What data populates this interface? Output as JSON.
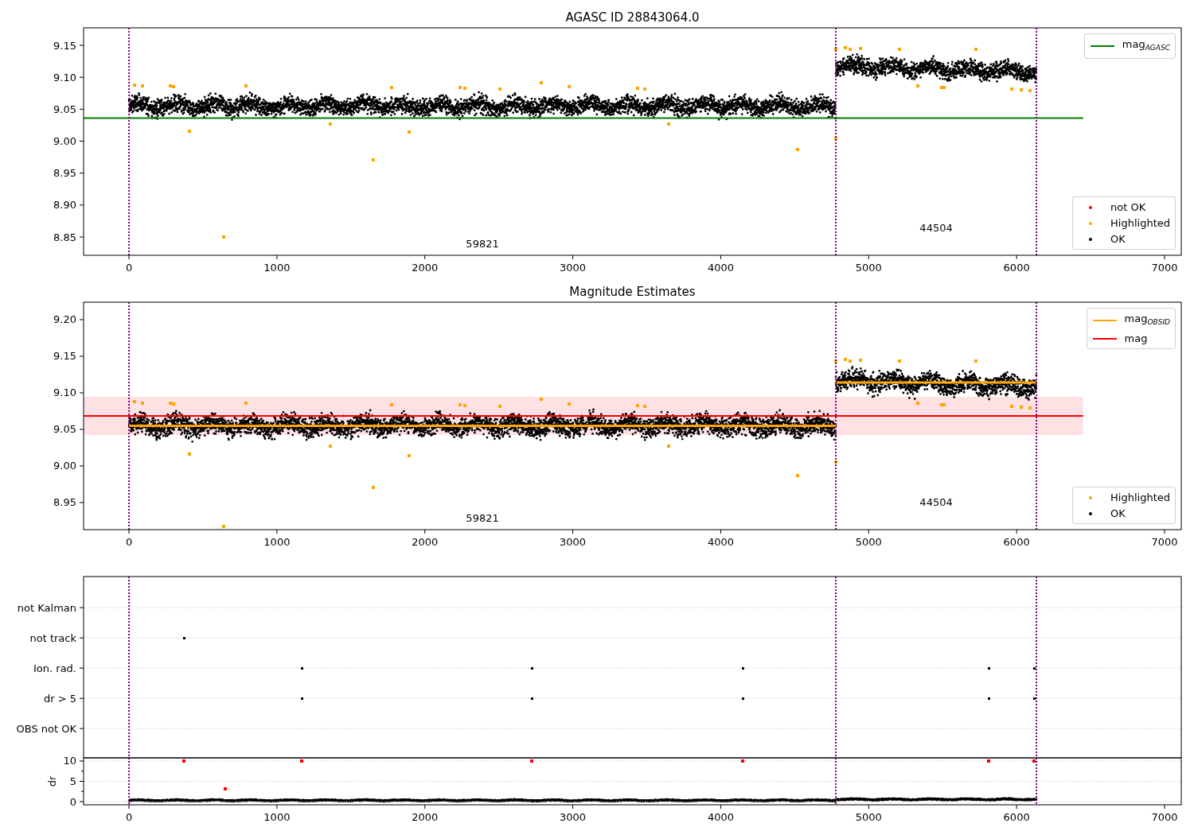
{
  "figure": {
    "panels": [
      {
        "kind": "magnitude",
        "title": "AGASC ID 28843064.0",
        "chart_data": {
          "type": "scatter",
          "xlim": [
            -307,
            7113
          ],
          "ylim": [
            8.8214,
            9.1774
          ],
          "xticks": [
            0,
            1000,
            2000,
            3000,
            4000,
            5000,
            6000,
            7000
          ],
          "yticks": [
            {
              "value": 8.85,
              "label": "8.85"
            },
            {
              "value": 8.9,
              "label": "8.90"
            },
            {
              "value": 8.95,
              "label": "8.95"
            },
            {
              "value": 9.0,
              "label": "9.00"
            },
            {
              "value": 9.05,
              "label": "9.05"
            },
            {
              "value": 9.1,
              "label": "9.10"
            },
            {
              "value": 9.15,
              "label": "9.15"
            }
          ],
          "series": [
            {
              "color": "#ffa500",
              "x": [
                38,
                91,
                280,
                301,
                409,
                640,
                791,
                1361,
                1652,
                1776,
                1894,
                2238,
                2270,
                2507,
                2787,
                2975,
                3438,
                3487,
                3648,
                4520,
                4778,
                4778,
                4843,
                4875,
                4945,
                5208,
                5332,
                5493,
                5509,
                5725,
                5967,
                6031,
                6091
              ],
              "values": [
                9.088,
                9.086,
                9.086,
                9.085,
                9.016,
                8.85,
                9.086,
                9.027,
                8.971,
                9.084,
                9.014,
                9.084,
                9.083,
                9.081,
                9.091,
                9.085,
                9.083,
                9.081,
                9.027,
                8.987,
                9.005,
                9.144,
                9.146,
                9.144,
                9.145,
                9.144,
                9.086,
                9.084,
                9.084,
                9.144,
                9.081,
                9.08,
                9.079
              ]
            }
          ],
          "ref_lines": [
            {
              "axis": "y",
              "value": 9.036,
              "color": "#008000"
            },
            {
              "axis": "x",
              "value": 0,
              "color": "#800080"
            },
            {
              "axis": "x",
              "value": 4778,
              "color": "#800080"
            },
            {
              "axis": "x",
              "value": 6134,
              "color": "#800080"
            }
          ],
          "annotations": [
            "59821",
            "44504"
          ]
        },
        "legends": [
          {
            "items": [
              {
                "label": "mag$_{AGASC}$",
                "kind": "line",
                "color": "#008000"
              }
            ]
          },
          {
            "items": [
              {
                "label": "not OK",
                "kind": "dot",
                "color": "#ff0000"
              },
              {
                "label": "Highlighted",
                "kind": "dot",
                "color": "#ffa500"
              },
              {
                "label": "OK",
                "kind": "dot",
                "color": "#000000"
              }
            ]
          }
        ]
      },
      {
        "kind": "magnitude",
        "title": "Magnitude Estimates",
        "chart_data": {
          "type": "scatter",
          "xlim": [
            -307,
            7113
          ],
          "ylim": [
            8.913,
            9.2239
          ],
          "xticks": [
            0,
            1000,
            2000,
            3000,
            4000,
            5000,
            6000,
            7000
          ],
          "yticks": [
            {
              "value": 8.95,
              "label": "8.95"
            },
            {
              "value": 9.0,
              "label": "9.00"
            },
            {
              "value": 9.05,
              "label": "9.05"
            },
            {
              "value": 9.1,
              "label": "9.10"
            },
            {
              "value": 9.15,
              "label": "9.15"
            },
            {
              "value": 9.2,
              "label": "9.20"
            }
          ],
          "series": [
            {
              "color": "#ffa500",
              "x": [
                38,
                91,
                280,
                301,
                409,
                640,
                791,
                1361,
                1652,
                1776,
                1894,
                2238,
                2270,
                2507,
                2787,
                2975,
                3438,
                3487,
                3648,
                4520,
                4778,
                4778,
                4843,
                4875,
                4945,
                5208,
                5332,
                5493,
                5509,
                5725,
                5967,
                6031,
                6091
              ],
              "values": [
                9.088,
                9.086,
                9.086,
                9.085,
                9.016,
                8.917,
                9.086,
                9.027,
                8.971,
                9.084,
                9.014,
                9.084,
                9.083,
                9.081,
                9.091,
                9.085,
                9.083,
                9.081,
                9.027,
                8.987,
                9.005,
                9.144,
                9.146,
                9.144,
                9.145,
                9.144,
                9.086,
                9.084,
                9.084,
                9.144,
                9.081,
                9.08,
                9.079
              ]
            },
            {
              "type": "line",
              "color": "#ffa500",
              "x": [
                0,
                4778
              ],
              "values": [
                9.055,
                9.055
              ]
            },
            {
              "type": "line",
              "color": "#ffa500",
              "x": [
                4778,
                6134
              ],
              "values": [
                9.114,
                9.114
              ]
            }
          ],
          "bands": [
            {
              "axis": "y",
              "from": 9.0424,
              "to": 9.0946,
              "color": "#ffe0e3"
            }
          ],
          "ref_lines": [
            {
              "axis": "y",
              "value": 9.0685,
              "color": "#ff0000"
            },
            {
              "axis": "x",
              "value": 0,
              "color": "#800080"
            },
            {
              "axis": "x",
              "value": 4778,
              "color": "#800080"
            },
            {
              "axis": "x",
              "value": 6134,
              "color": "#800080"
            }
          ],
          "annotations": [
            "59821",
            "44504"
          ]
        },
        "legends": [
          {
            "items": [
              {
                "label": "mag$_{OBSID}$",
                "kind": "line",
                "color": "#ffa500"
              },
              {
                "label": "mag",
                "kind": "line",
                "color": "#ff0000"
              }
            ]
          },
          {
            "items": [
              {
                "label": "Highlighted",
                "kind": "dot",
                "color": "#ffa500"
              },
              {
                "label": "OK",
                "kind": "dot",
                "color": "#000000"
              }
            ]
          }
        ]
      },
      {
        "kind": "flags",
        "flag_labels": [
          "not Kalman",
          "not track",
          "Ion. rad.",
          "dr > 5",
          "OBS not OK"
        ]
      },
      {
        "kind": "dr",
        "chart_data": {
          "type": "scatter",
          "grid": true,
          "ylabel": "dr",
          "xlim": [
            -307,
            7113
          ],
          "ylim": [
            -0.78,
            10.78
          ],
          "xticks": [
            0,
            1000,
            2000,
            3000,
            4000,
            5000,
            6000,
            7000
          ],
          "yticks": [
            0,
            5,
            10
          ],
          "series": [
            {
              "color": "#ff0000",
              "x": [
                370,
                1170,
                2720,
                4150,
                5810,
                6120,
                650
              ],
              "values": [
                10,
                10,
                10,
                10,
                10,
                10,
                3.1
              ]
            }
          ],
          "ref_lines": [
            {
              "axis": "x",
              "value": 0,
              "color": "#800080"
            },
            {
              "axis": "x",
              "value": 4778,
              "color": "#800080"
            },
            {
              "axis": "x",
              "value": 6134,
              "color": "#800080"
            }
          ]
        }
      }
    ]
  }
}
